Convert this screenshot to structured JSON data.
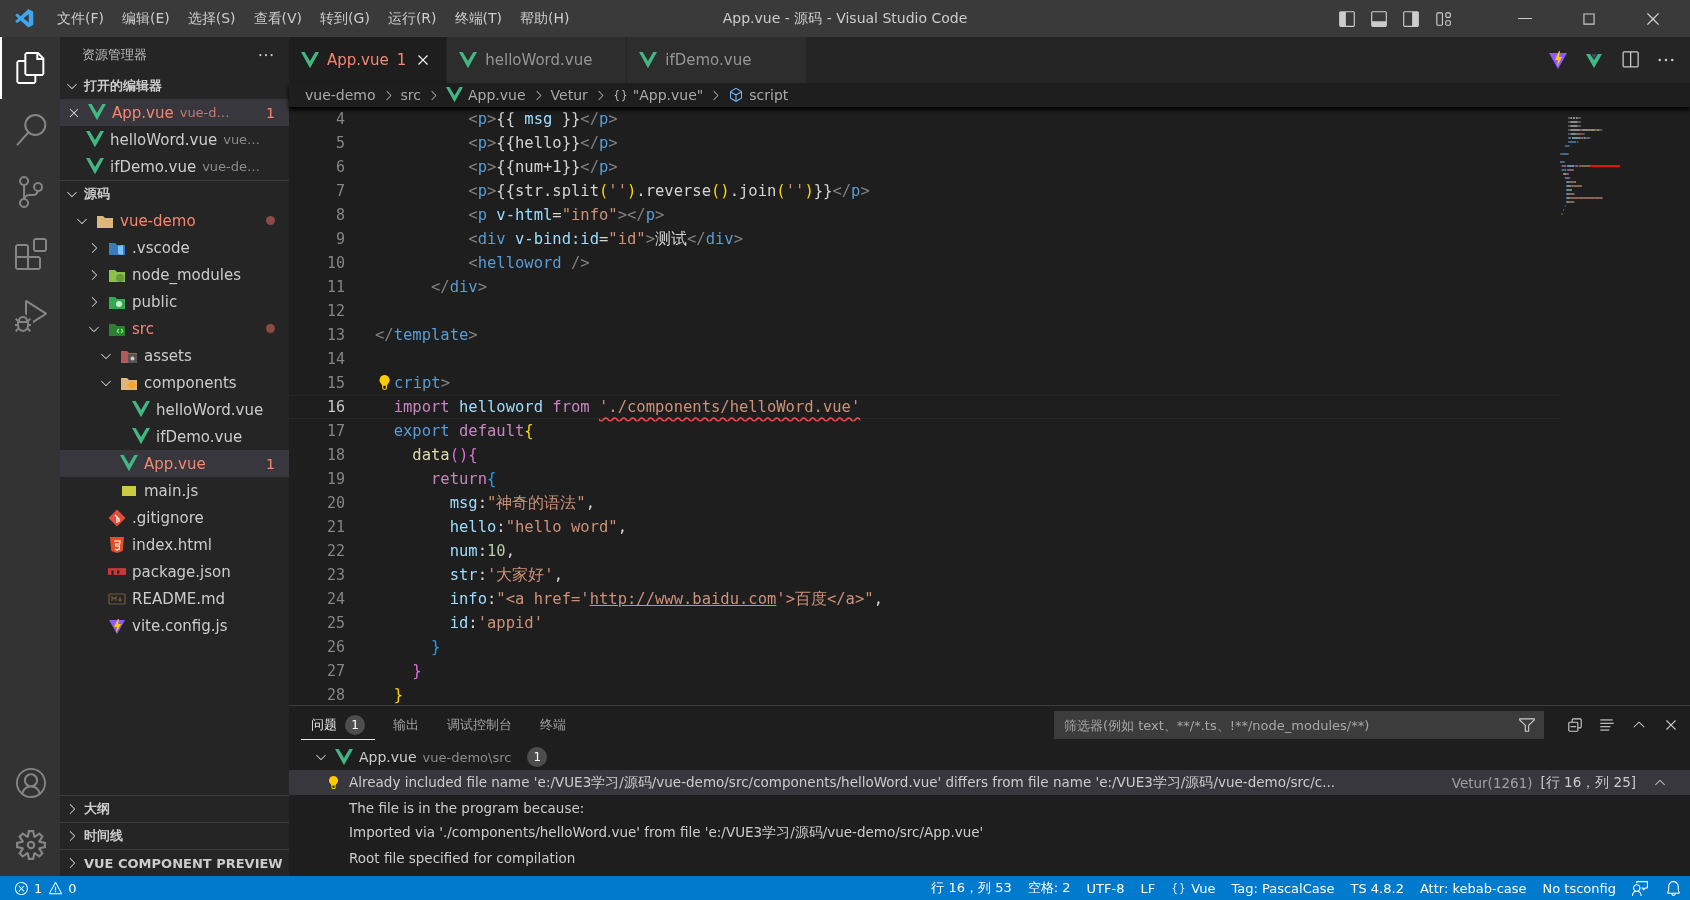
{
  "title_bar": {
    "menu": [
      "文件(F)",
      "编辑(E)",
      "选择(S)",
      "查看(V)",
      "转到(G)",
      "运行(R)",
      "终端(T)",
      "帮助(H)"
    ],
    "title": "App.vue - 源码 - Visual Studio Code"
  },
  "activity_bar": [
    {
      "kind": "explorer",
      "selected": true
    },
    {
      "kind": "search",
      "selected": false
    },
    {
      "kind": "scm",
      "selected": false
    },
    {
      "kind": "extensions",
      "selected": false
    },
    {
      "kind": "debug",
      "selected": false
    }
  ],
  "sidebar": {
    "title": "资源管理器",
    "open_editors": {
      "label": "打开的编辑器",
      "expanded": true,
      "items": [
        {
          "name": "App.vue",
          "path": "vue-d…",
          "badge": "1",
          "error": true,
          "selected": true
        },
        {
          "name": "helloWord.vue",
          "path": "vue…",
          "error": false,
          "selected": false
        },
        {
          "name": "ifDemo.vue",
          "path": "vue-de…",
          "error": false,
          "selected": false
        }
      ]
    },
    "folder": {
      "label": "源码",
      "expanded": true,
      "tree": [
        {
          "name": "vue-demo",
          "kind": "folder",
          "expanded": true,
          "error": true,
          "modified": true,
          "selected": false,
          "children": [
            {
              "name": ".vscode",
              "kind": "vscode-folder",
              "expanded": false,
              "error": false,
              "modified": false,
              "selected": false
            },
            {
              "name": "node_modules",
              "kind": "node-folder",
              "expanded": false,
              "error": false,
              "modified": false,
              "selected": false
            },
            {
              "name": "public",
              "kind": "public-folder",
              "expanded": false,
              "error": false,
              "modified": false,
              "selected": false
            },
            {
              "name": "src",
              "kind": "src-folder",
              "expanded": true,
              "error": true,
              "modified": true,
              "selected": false,
              "children": [
                {
                  "name": "assets",
                  "kind": "assets-folder",
                  "expanded": true,
                  "error": false,
                  "modified": false,
                  "selected": false
                },
                {
                  "name": "components",
                  "kind": "components-folder",
                  "expanded": true,
                  "error": false,
                  "modified": false,
                  "selected": false,
                  "children": [
                    {
                      "name": "helloWord.vue",
                      "kind": "vue",
                      "error": false,
                      "modified": false,
                      "selected": false
                    },
                    {
                      "name": "ifDemo.vue",
                      "kind": "vue",
                      "error": false,
                      "modified": false,
                      "selected": false
                    }
                  ]
                },
                {
                  "name": "App.vue",
                  "kind": "vue",
                  "badge": "1",
                  "error": true,
                  "modified": false,
                  "selected": true
                },
                {
                  "name": "main.js",
                  "kind": "js",
                  "error": false,
                  "modified": false,
                  "selected": false
                }
              ]
            },
            {
              "name": ".gitignore",
              "kind": "git",
              "error": false,
              "modified": false,
              "selected": false
            },
            {
              "name": "index.html",
              "kind": "html",
              "error": false,
              "modified": false,
              "selected": false
            },
            {
              "name": "package.json",
              "kind": "npm",
              "error": false,
              "modified": false,
              "selected": false
            },
            {
              "name": "README.md",
              "kind": "md",
              "error": false,
              "modified": false,
              "selected": false
            },
            {
              "name": "vite.config.js",
              "kind": "vite",
              "error": false,
              "modified": false,
              "selected": false
            }
          ]
        }
      ]
    },
    "bottom_sections": [
      {
        "label": "大纲",
        "expanded": false
      },
      {
        "label": "时间线",
        "expanded": false
      },
      {
        "label": "VUE COMPONENT PREVIEW",
        "expanded": false
      }
    ]
  },
  "tabs": [
    {
      "label": "App.vue",
      "badge": "1",
      "error": true,
      "selected": true
    },
    {
      "label": "helloWord.vue",
      "error": false,
      "selected": false
    },
    {
      "label": "ifDemo.vue",
      "error": false,
      "selected": false
    }
  ],
  "breadcrumb": [
    {
      "kind": "text",
      "label": "vue-demo"
    },
    {
      "kind": "text",
      "label": "src"
    },
    {
      "kind": "vue",
      "label": "App.vue"
    },
    {
      "kind": "text",
      "label": "Vetur"
    },
    {
      "kind": "braces",
      "label": "\"App.vue\""
    },
    {
      "kind": "cube",
      "label": "script"
    }
  ],
  "code": [
    {
      "n": "4",
      "current": false,
      "bulb": false,
      "tokens": [
        {
          "kind": "p",
          "text": "          <"
        },
        {
          "kind": "tag",
          "text": "p"
        },
        {
          "kind": "p",
          "text": ">"
        },
        {
          "kind": "tx",
          "text": "{{ "
        },
        {
          "kind": "at",
          "text": "msg"
        },
        {
          "kind": "tx",
          "text": " }}"
        },
        {
          "kind": "p",
          "text": "</"
        },
        {
          "kind": "tag",
          "text": "p"
        },
        {
          "kind": "p",
          "text": ">"
        }
      ]
    },
    {
      "n": "5",
      "current": false,
      "bulb": false,
      "tokens": [
        {
          "kind": "p",
          "text": "          <"
        },
        {
          "kind": "tag",
          "text": "p"
        },
        {
          "kind": "p",
          "text": ">"
        },
        {
          "kind": "tx",
          "text": "{{hello}}"
        },
        {
          "kind": "p",
          "text": "</"
        },
        {
          "kind": "tag",
          "text": "p"
        },
        {
          "kind": "p",
          "text": ">"
        }
      ]
    },
    {
      "n": "6",
      "current": false,
      "bulb": false,
      "tokens": [
        {
          "kind": "p",
          "text": "          <"
        },
        {
          "kind": "tag",
          "text": "p"
        },
        {
          "kind": "p",
          "text": ">"
        },
        {
          "kind": "tx",
          "text": "{{num+1}}"
        },
        {
          "kind": "p",
          "text": "</"
        },
        {
          "kind": "tag",
          "text": "p"
        },
        {
          "kind": "p",
          "text": ">"
        }
      ]
    },
    {
      "n": "7",
      "current": false,
      "bulb": false,
      "tokens": [
        {
          "kind": "p",
          "text": "          <"
        },
        {
          "kind": "tag",
          "text": "p"
        },
        {
          "kind": "p",
          "text": ">"
        },
        {
          "kind": "tx",
          "text": "{{str.split"
        },
        {
          "kind": "b1",
          "text": "("
        },
        {
          "kind": "s",
          "text": "''"
        },
        {
          "kind": "b1",
          "text": ")"
        },
        {
          "kind": "tx",
          "text": ".reverse"
        },
        {
          "kind": "b1",
          "text": "()"
        },
        {
          "kind": "tx",
          "text": ".join"
        },
        {
          "kind": "b1",
          "text": "("
        },
        {
          "kind": "s",
          "text": "''"
        },
        {
          "kind": "b1",
          "text": ")"
        },
        {
          "kind": "tx",
          "text": "}}"
        },
        {
          "kind": "p",
          "text": "</"
        },
        {
          "kind": "tag",
          "text": "p"
        },
        {
          "kind": "p",
          "text": ">"
        }
      ]
    },
    {
      "n": "8",
      "current": false,
      "bulb": false,
      "tokens": [
        {
          "kind": "p",
          "text": "          <"
        },
        {
          "kind": "tag",
          "text": "p"
        },
        {
          "kind": "at",
          "text": " v-html"
        },
        {
          "kind": "tx",
          "text": "="
        },
        {
          "kind": "s",
          "text": "\"info\""
        },
        {
          "kind": "p",
          "text": "></"
        },
        {
          "kind": "tag",
          "text": "p"
        },
        {
          "kind": "p",
          "text": ">"
        }
      ]
    },
    {
      "n": "9",
      "current": false,
      "bulb": false,
      "tokens": [
        {
          "kind": "p",
          "text": "          <"
        },
        {
          "kind": "tag",
          "text": "div"
        },
        {
          "kind": "at",
          "text": " v-bind:id"
        },
        {
          "kind": "tx",
          "text": "="
        },
        {
          "kind": "s",
          "text": "\"id\""
        },
        {
          "kind": "p",
          "text": ">"
        },
        {
          "kind": "tx",
          "text": "测试"
        },
        {
          "kind": "p",
          "text": "</"
        },
        {
          "kind": "tag",
          "text": "div"
        },
        {
          "kind": "p",
          "text": ">"
        }
      ]
    },
    {
      "n": "10",
      "current": false,
      "bulb": false,
      "tokens": [
        {
          "kind": "p",
          "text": "          <"
        },
        {
          "kind": "tag",
          "text": "helloword"
        },
        {
          "kind": "p",
          "text": " />"
        }
      ]
    },
    {
      "n": "11",
      "current": false,
      "bulb": false,
      "tokens": [
        {
          "kind": "p",
          "text": "      </"
        },
        {
          "kind": "tag",
          "text": "div"
        },
        {
          "kind": "p",
          "text": ">"
        }
      ]
    },
    {
      "n": "12",
      "current": false,
      "bulb": false
    },
    {
      "n": "13",
      "current": false,
      "bulb": false,
      "tokens": [
        {
          "kind": "p",
          "text": "</"
        },
        {
          "kind": "tag",
          "text": "template"
        },
        {
          "kind": "p",
          "text": ">"
        }
      ]
    },
    {
      "n": "14",
      "current": false,
      "bulb": false
    },
    {
      "n": "15",
      "current": false,
      "bulb": true,
      "tokens": [
        {
          "kind": "tag",
          "text": "cript"
        },
        {
          "kind": "p",
          "text": ">"
        }
      ]
    },
    {
      "n": "16",
      "current": true,
      "bulb": false,
      "tokens": [
        {
          "kind": "kw",
          "text": "  import"
        },
        {
          "kind": "at",
          "text": " helloword"
        },
        {
          "kind": "kw",
          "text": " from "
        },
        {
          "kind": "se",
          "text": "'./components/helloWord.vue'"
        }
      ]
    },
    {
      "n": "17",
      "current": false,
      "bulb": false,
      "tokens": [
        {
          "kind": "tag",
          "text": "  export"
        },
        {
          "kind": "kw",
          "text": " default"
        },
        {
          "kind": "b1",
          "text": "{"
        }
      ]
    },
    {
      "n": "18",
      "current": false,
      "bulb": false,
      "tokens": [
        {
          "kind": "fn",
          "text": "    data"
        },
        {
          "kind": "b2",
          "text": "(){"
        }
      ]
    },
    {
      "n": "19",
      "current": false,
      "bulb": false,
      "tokens": [
        {
          "kind": "kw",
          "text": "      return"
        },
        {
          "kind": "b3",
          "text": "{"
        }
      ]
    },
    {
      "n": "20",
      "current": false,
      "bulb": false,
      "tokens": [
        {
          "kind": "at",
          "text": "        msg"
        },
        {
          "kind": "tx",
          "text": ":"
        },
        {
          "kind": "s",
          "text": "\"神奇的语法\""
        },
        {
          "kind": "tx",
          "text": ","
        }
      ]
    },
    {
      "n": "21",
      "current": false,
      "bulb": false,
      "tokens": [
        {
          "kind": "at",
          "text": "        hello"
        },
        {
          "kind": "tx",
          "text": ":"
        },
        {
          "kind": "s",
          "text": "\"hello word\""
        },
        {
          "kind": "tx",
          "text": ","
        }
      ]
    },
    {
      "n": "22",
      "current": false,
      "bulb": false,
      "tokens": [
        {
          "kind": "at",
          "text": "        num"
        },
        {
          "kind": "tx",
          "text": ":"
        },
        {
          "kind": "nm",
          "text": "10"
        },
        {
          "kind": "tx",
          "text": ","
        }
      ]
    },
    {
      "n": "23",
      "current": false,
      "bulb": false,
      "tokens": [
        {
          "kind": "at",
          "text": "        str"
        },
        {
          "kind": "tx",
          "text": ":"
        },
        {
          "kind": "s",
          "text": "'大家好'"
        },
        {
          "kind": "tx",
          "text": ","
        }
      ]
    },
    {
      "n": "24",
      "current": false,
      "bulb": false,
      "tokens": [
        {
          "kind": "at",
          "text": "        info"
        },
        {
          "kind": "tx",
          "text": ":"
        },
        {
          "kind": "s",
          "text": "\"<a href='"
        },
        {
          "kind": "u",
          "text": "http://www.baidu.com"
        },
        {
          "kind": "s",
          "text": "'>百度</a>\""
        },
        {
          "kind": "tx",
          "text": ","
        }
      ]
    },
    {
      "n": "25",
      "current": false,
      "bulb": false,
      "tokens": [
        {
          "kind": "at",
          "text": "        id"
        },
        {
          "kind": "tx",
          "text": ":"
        },
        {
          "kind": "s",
          "text": "'appid'"
        }
      ]
    },
    {
      "n": "26",
      "current": false,
      "bulb": false,
      "tokens": [
        {
          "kind": "b3",
          "text": "      }"
        }
      ]
    },
    {
      "n": "27",
      "current": false,
      "bulb": false,
      "tokens": [
        {
          "kind": "b2",
          "text": "    }"
        }
      ]
    },
    {
      "n": "28",
      "current": false,
      "bulb": false,
      "tokens": [
        {
          "kind": "b1",
          "text": "  }"
        }
      ]
    }
  ],
  "panel": {
    "tabs": [
      {
        "label": "问题",
        "badge": "1",
        "selected": true
      },
      {
        "label": "输出",
        "selected": false
      },
      {
        "label": "调试控制台",
        "selected": false
      },
      {
        "label": "终端",
        "selected": false
      }
    ],
    "filter": {
      "placeholder": "筛选器(例如 text、**/*.ts、!**/node_modules/**)"
    },
    "file": {
      "name": "App.vue",
      "path": "vue-demo\\src",
      "badge": "1",
      "expanded": true
    },
    "messages": [
      {
        "text": "Already included file name 'e:/VUE3学习/源码/vue-demo/src/components/helloWord.vue' differs from file name 'e:/VUE3学习/源码/vue-demo/src/c...",
        "source": "Vetur(1261)",
        "location": "[行 16，列 25]",
        "selected": true,
        "bulb": true
      },
      {
        "text": "The file is in the program because:",
        "selected": false,
        "bulb": false
      },
      {
        "text": "Imported via './components/helloWord.vue' from file 'e:/VUE3学习/源码/vue-demo/src/App.vue'",
        "selected": false,
        "bulb": false
      },
      {
        "text": "Root file specified for compilation",
        "selected": false,
        "bulb": false
      }
    ]
  },
  "status_bar": {
    "errors": "1",
    "warnings": "0",
    "items": [
      {
        "kind": "text",
        "label": "行 16，列 53"
      },
      {
        "kind": "text",
        "label": "空格: 2"
      },
      {
        "kind": "text",
        "label": "UTF-8"
      },
      {
        "kind": "text",
        "label": "LF"
      },
      {
        "kind": "braces",
        "label": "Vue"
      },
      {
        "kind": "text",
        "label": "Tag: PascalCase"
      },
      {
        "kind": "text",
        "label": "TS 4.8.2"
      },
      {
        "kind": "text",
        "label": "Attr: kebab-case"
      },
      {
        "kind": "text",
        "label": "No tsconfig"
      }
    ]
  }
}
